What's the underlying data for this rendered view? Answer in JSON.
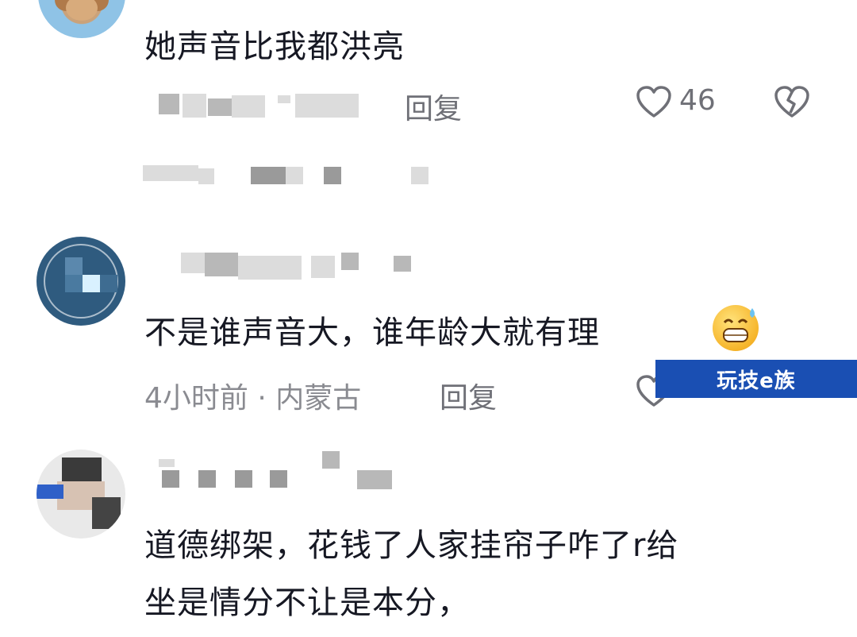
{
  "comments": [
    {
      "text": "她声音比我都洪亮",
      "meta": "",
      "reply_label": "回复",
      "like_count": "46"
    },
    {
      "text": "不是谁声音大，谁年龄大就有理",
      "meta": "4小时前 · 内蒙古",
      "reply_label": "回复",
      "like_count": ""
    },
    {
      "text_line1": "道德绑架，花钱了人家挂帘子咋了r给",
      "text_line2": "坐是情分不让是本分，"
    }
  ],
  "watermark": "玩技e族",
  "icons": [
    "heart-outline-icon",
    "broken-heart-icon",
    "grin-sweat-emoji"
  ],
  "colors": {
    "text": "#161823",
    "meta": "#8a8b91",
    "watermark_bg": "#1a4fb3"
  }
}
